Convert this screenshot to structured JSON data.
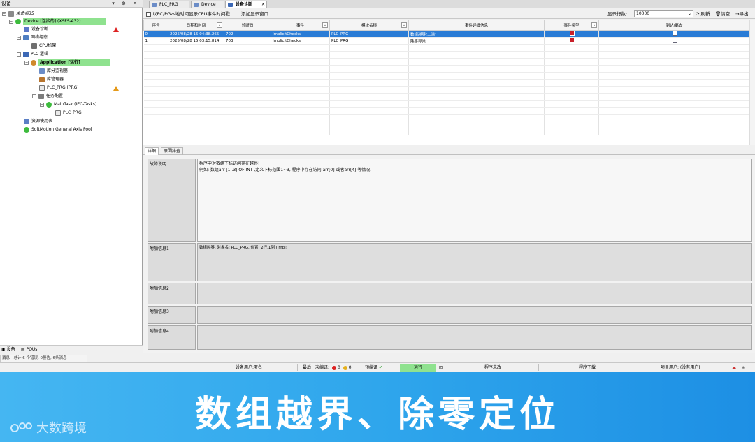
{
  "left_panel": {
    "title": "设备",
    "title_buttons": "▾ ⊕ ✕",
    "tree": [
      {
        "label": "未命名35",
        "icon": "project-icon"
      },
      {
        "label": "Device [连接的] (XSFS-A32)",
        "icon": "device-icon"
      },
      {
        "label": "设备诊断",
        "icon": "diagnosis-icon"
      },
      {
        "label": "网络组态",
        "icon": "network-icon"
      },
      {
        "label": "CPU机架",
        "icon": "rack-icon"
      },
      {
        "label": "PLC 逻辑",
        "icon": "plc-logic-icon"
      },
      {
        "label": "Application [运行]",
        "icon": "application-icon"
      },
      {
        "label": "库分监视器",
        "icon": "monitor-icon"
      },
      {
        "label": "库管理器",
        "icon": "library-icon"
      },
      {
        "label": "PLC_PRG (PRG)",
        "icon": "pou-icon"
      },
      {
        "label": "任务配置",
        "icon": "task-config-icon"
      },
      {
        "label": "MainTask (IEC-Tasks)",
        "icon": "task-icon"
      },
      {
        "label": "PLC_PRG",
        "icon": "pou-call-icon"
      },
      {
        "label": "资源使用表",
        "icon": "resource-icon"
      },
      {
        "label": "SoftMotion General Axis Pool",
        "icon": "axis-pool-icon"
      }
    ],
    "bottom_tabs": {
      "devices": "设备",
      "pous": "POUs"
    },
    "message_bar": "消息 - 总计 6 个错误, 0警告, 6条消息"
  },
  "doc_tabs": [
    {
      "label": "PLC_PRG"
    },
    {
      "label": "Device"
    },
    {
      "label": "设备诊断"
    }
  ],
  "toolbar": {
    "cpu_events_label": "以PC/PG本地时间显示CPU事件时间戳",
    "add_window_label": "添加显示窗口",
    "rows_label": "显示行数:",
    "rows_value": "10000",
    "refresh": "刷新",
    "clear": "清空",
    "export": "导出"
  },
  "table": {
    "columns": [
      "序号",
      "日期和时间",
      "诊断码",
      "事件",
      "模块名称",
      "事件详细信息",
      "事件类型",
      "到达/离去"
    ],
    "rows": [
      {
        "index": "0",
        "datetime": "2025/08/28 15:04:38.265",
        "code": "702",
        "event": "ImplicitChecks",
        "module": "PLC_PRG",
        "detail": "数组越界(上溢)"
      },
      {
        "index": "1",
        "datetime": "2025/08/28 15:03:15.814",
        "code": "703",
        "event": "ImplicitChecks",
        "module": "PLC_PRG",
        "detail": "除零异常"
      }
    ]
  },
  "detail": {
    "tabs": [
      "详细",
      "原因排查"
    ],
    "fault_label": "故障说明",
    "fault_text": "程序中对数组下标访问存在越界!\n例如: 数组arr [1..3] OF INT ,定义下标范围1~3, 程序中存在访问 arr[0] 或者arr[4] 等情况!",
    "extra1_label": "附加信息1",
    "extra1_text": "数组越界, 对象名: PLC_PRG, 位置: 2行,1列 (Impl)",
    "extra2_label": "附加信息2",
    "extra3_label": "附加信息3",
    "extra4_label": "附加信息4"
  },
  "status_bar": {
    "device_user": "设备用户:匿名",
    "last_compile": "最后一次编译:",
    "errors": "0",
    "warnings": "0",
    "precompile": "预编译",
    "run": "运行",
    "program_unchanged": "程序未改",
    "program_download": "程序下载",
    "project_user": "项目用户: (没有用户)"
  },
  "banner": {
    "title": "数组越界、除零定位",
    "logo_text": "大数跨境"
  },
  "colors": {
    "selection": "#2a7cd6",
    "banner_start": "#45b6f2",
    "banner_end": "#1d8fe4",
    "highlight_green": "#8fe28f"
  }
}
